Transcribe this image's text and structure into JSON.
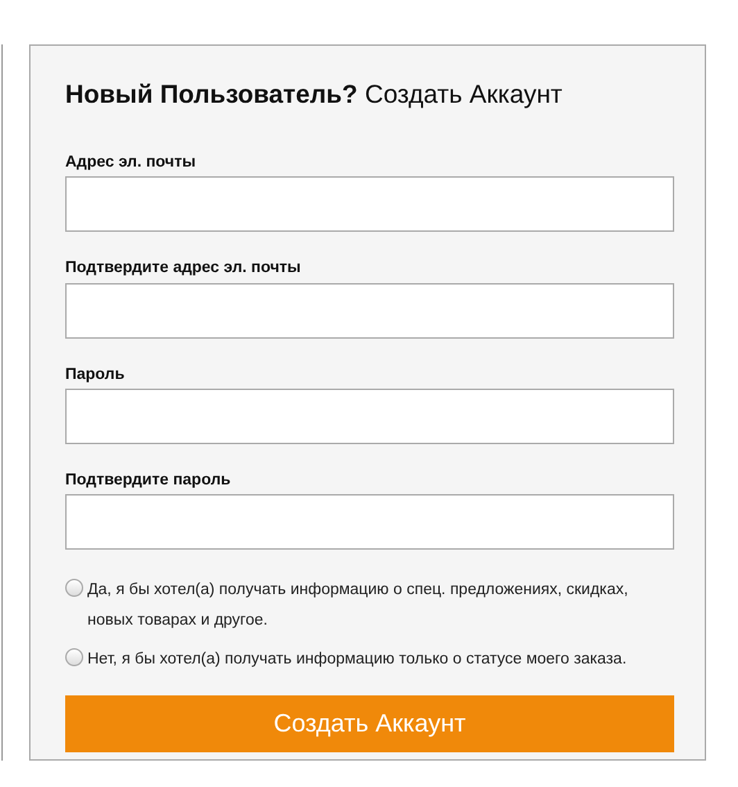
{
  "heading": "**Новый Пользователь?** Создать Аккаунт",
  "fields": [
    {
      "label": "Адрес эл. почты"
    },
    {
      "label": "Подтвердите адрес эл. почты"
    },
    {
      "label": "Пароль"
    },
    {
      "label": "Подтвердите пароль"
    }
  ],
  "options": [
    {
      "label": "Да, я бы хотел(а) получать информацию о спец. предложениях, скидках, новых товарах и другое.",
      "selected": false
    },
    {
      "label": "Нет, я бы хотел(а) получать информацию только о статусе моего заказа.",
      "selected": false
    }
  ],
  "submit_button": "Создать Аккаунт"
}
